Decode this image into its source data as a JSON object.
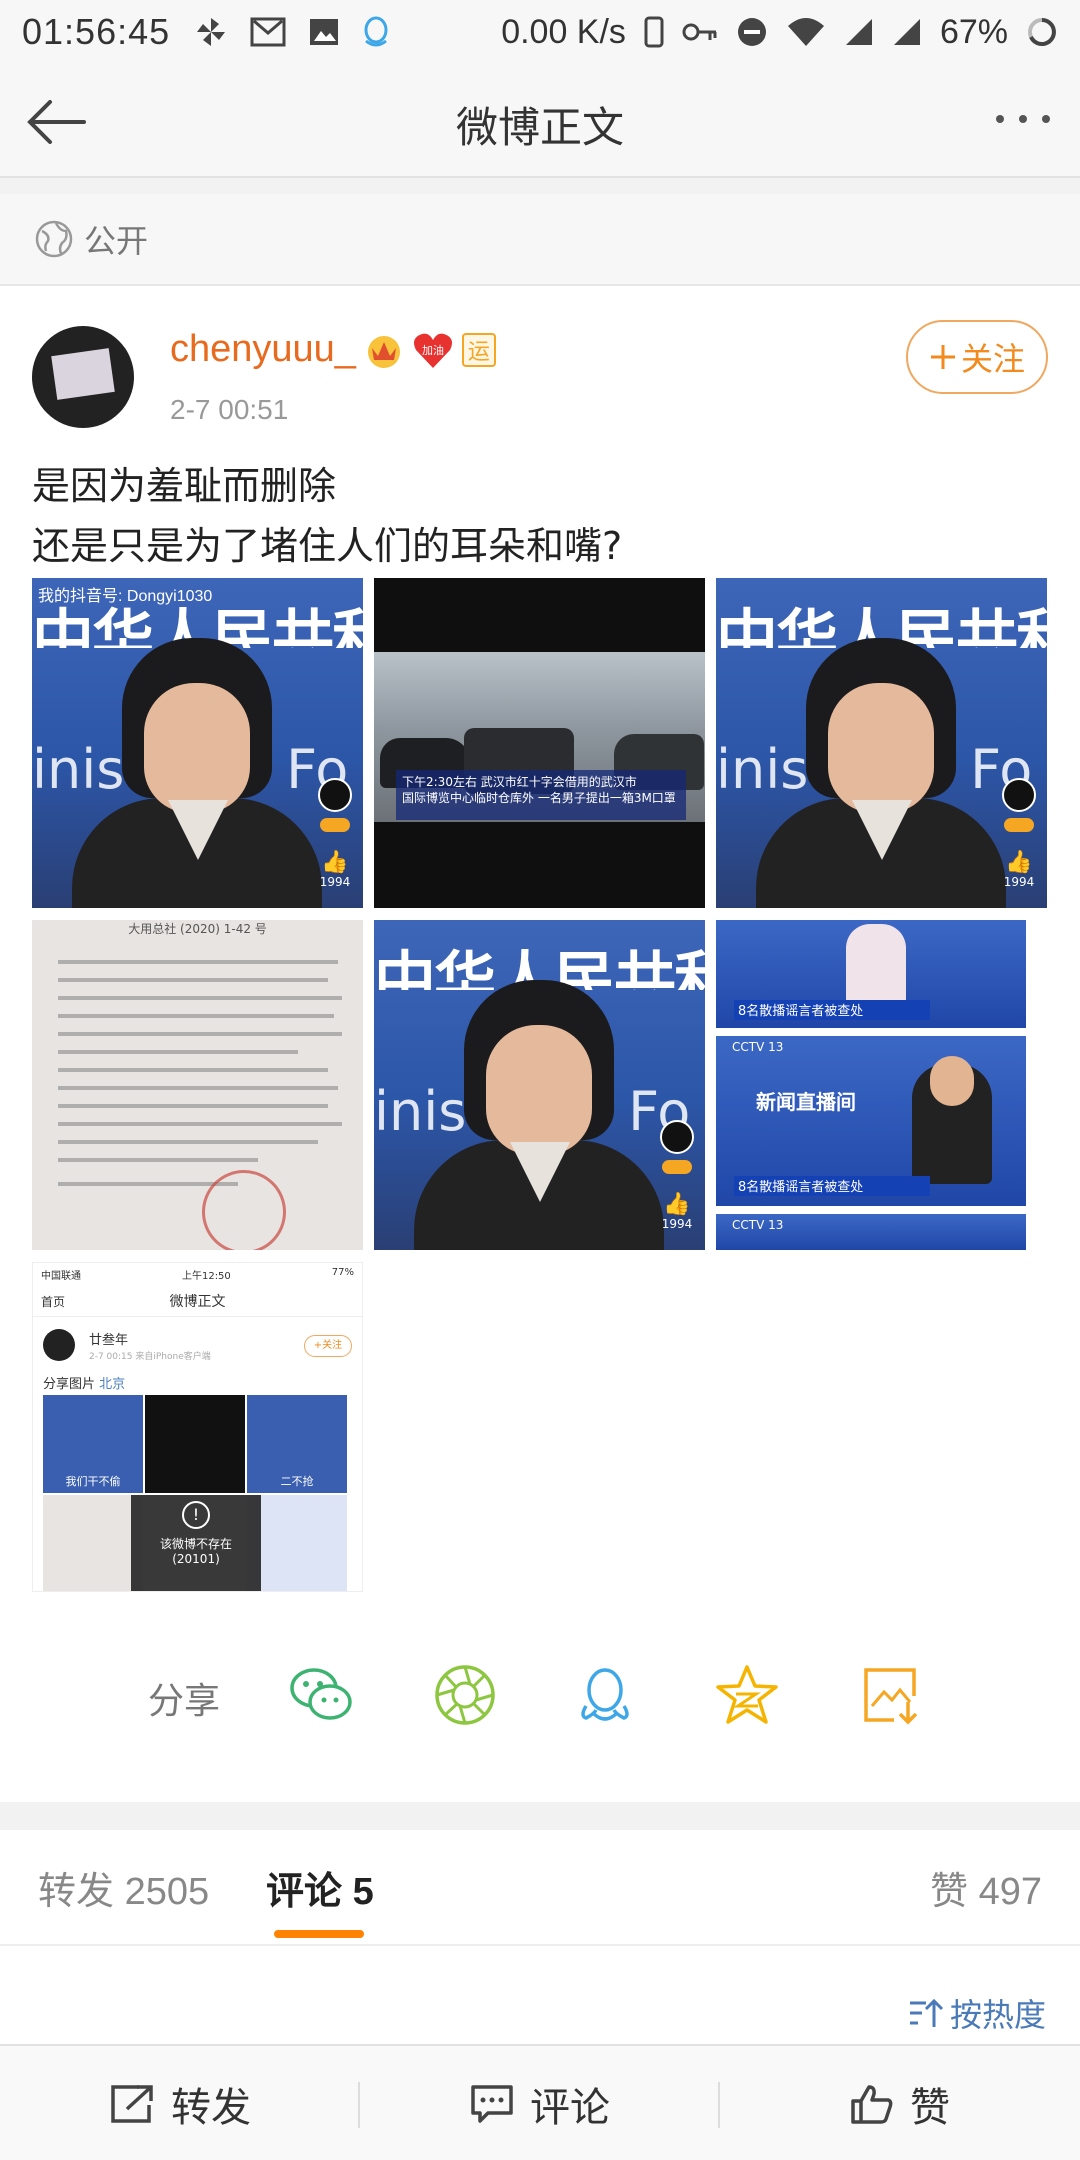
{
  "status_bar": {
    "time": "01:56:45",
    "speed": "0.00 K/s",
    "battery": "67%"
  },
  "nav": {
    "title": "微博正文"
  },
  "visibility": "公开",
  "post": {
    "username": "chenyuuu_",
    "badge_heart_text": "加油",
    "badge_yun": "运",
    "time": "2-7 00:51",
    "follow_label": "关注",
    "text_line1": "是因为羞耻而删除",
    "text_line2": "还是只是为了堵住人们的耳朵和嘴?",
    "images": {
      "p1_watermark": "我的抖音号: Dongyi1030",
      "spokes_banner": "中华人民共和",
      "spokes_banner2": "inistry of Fo",
      "like_count": "1994",
      "news_sub_line1": "下午2:30左右 武汉市红十字会借用的武汉市",
      "news_sub_line2": "国际博览中心临时仓库外 一名男子提出一箱3M口罩",
      "doc_header": "大用总社 (2020) 1-42 号",
      "stack_bar1": "8名散播谣言者被查处",
      "stack_bar2": "8名散播谣言者被查处",
      "live_text": "新闻直播间",
      "cctv": "CCTV 13",
      "shot": {
        "carrier": "中国联通",
        "time": "上午12:50",
        "battery": "77%",
        "back": "首页",
        "title": "微博正文",
        "username": "廿叁年",
        "meta": "2-7 00:15 来自iPhone客户端",
        "follow": "+关注",
        "share_text": "分享图片",
        "location": "北京",
        "cap1": "我们干不偷",
        "cap3": "二不抢",
        "deleted": "该微博不存在",
        "deleted_code": "(20101)"
      }
    }
  },
  "share": {
    "label": "分享",
    "icons": [
      "wechat-icon",
      "moments-icon",
      "qq-icon",
      "qzone-icon",
      "save-image-icon"
    ],
    "colors": {
      "wechat": "#3cb371",
      "moments": "#8dc63f",
      "qq": "#3ea7e8",
      "qzone": "#f5b400",
      "save": "#f5a623"
    }
  },
  "tabs": {
    "repost_label": "转发",
    "repost_count": "2505",
    "comment_label": "评论",
    "comment_count": "5",
    "like_label": "赞",
    "like_count": "497",
    "accent": "#ff8200"
  },
  "sort_label": "按热度",
  "bottom_bar": {
    "repost": "转发",
    "comment": "评论",
    "like": "赞"
  }
}
